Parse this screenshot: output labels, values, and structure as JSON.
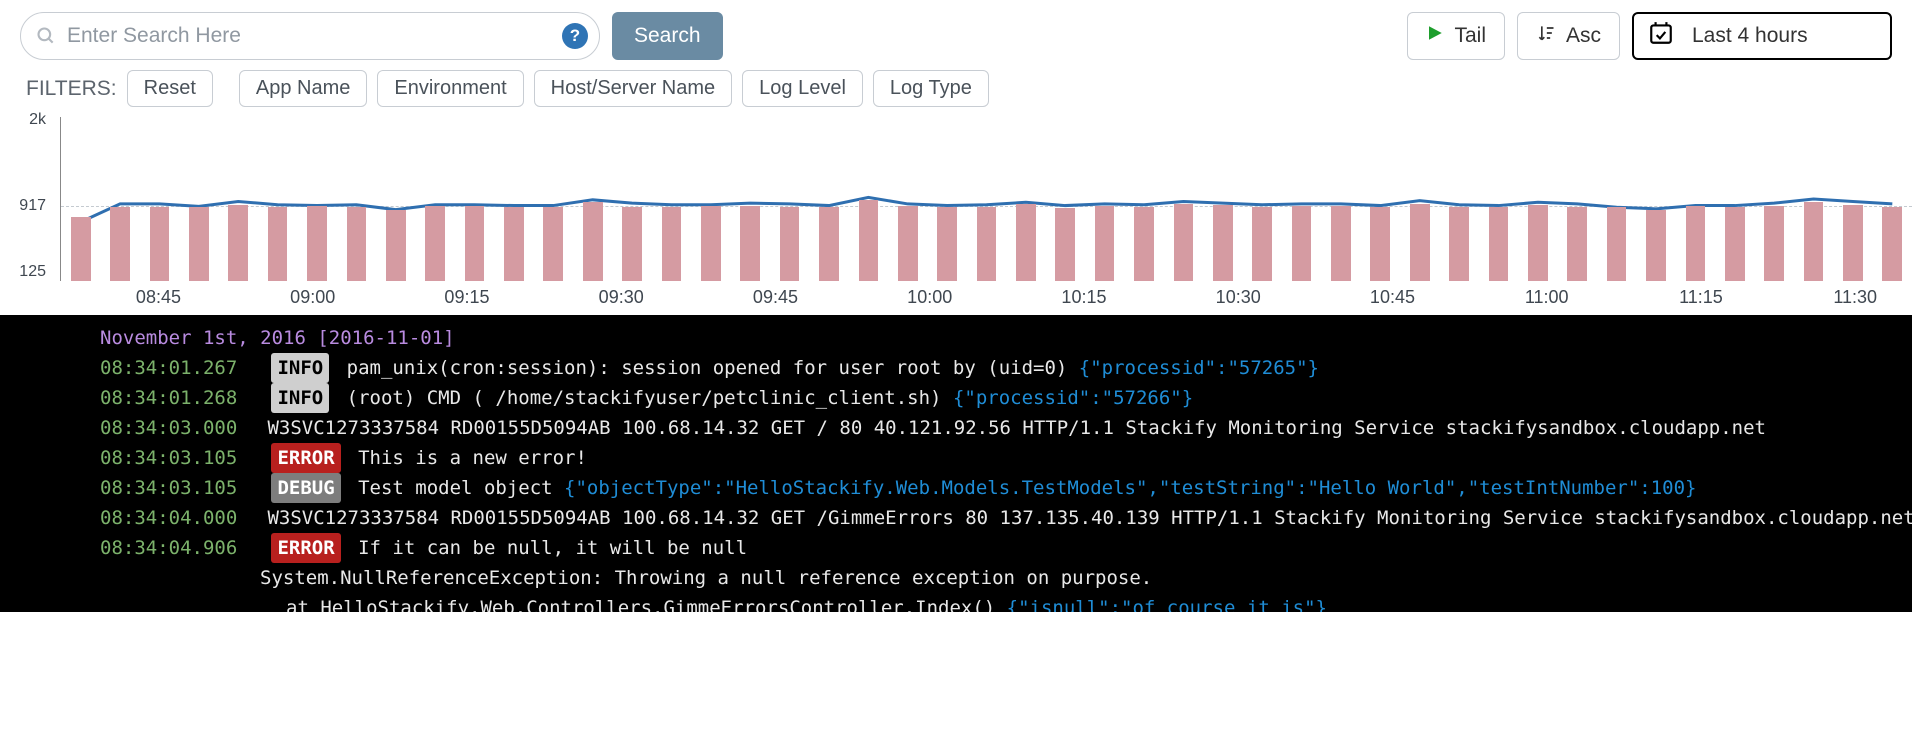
{
  "search": {
    "placeholder": "Enter Search Here",
    "button_label": "Search"
  },
  "toolbar": {
    "tail_label": "Tail",
    "sort_label": "Asc",
    "range_label": "Last 4 hours"
  },
  "filters": {
    "title": "FILTERS:",
    "reset": "Reset",
    "chips": [
      "App Name",
      "Environment",
      "Host/Server Name",
      "Log Level",
      "Log Type"
    ]
  },
  "chart_data": {
    "type": "bar+line",
    "ylabel": "",
    "yticks": [
      2000,
      917,
      125
    ],
    "ytick_labels": [
      "2k",
      "917",
      "125"
    ],
    "ylim": [
      0,
      2000
    ],
    "xticks": [
      "08:45",
      "09:00",
      "09:15",
      "09:30",
      "09:45",
      "10:00",
      "10:15",
      "10:30",
      "10:45",
      "11:00",
      "11:15",
      "11:30"
    ],
    "bars": [
      780,
      900,
      900,
      900,
      930,
      900,
      910,
      900,
      860,
      910,
      920,
      900,
      900,
      960,
      900,
      900,
      910,
      920,
      900,
      900,
      990,
      910,
      900,
      900,
      940,
      890,
      920,
      900,
      940,
      930,
      900,
      920,
      910,
      900,
      940,
      900,
      900,
      930,
      900,
      900,
      870,
      910,
      900,
      920,
      960,
      930,
      900
    ],
    "line": [
      720,
      940,
      940,
      910,
      970,
      930,
      920,
      930,
      870,
      930,
      930,
      920,
      920,
      990,
      950,
      930,
      930,
      950,
      940,
      920,
      1020,
      940,
      920,
      930,
      960,
      920,
      940,
      930,
      970,
      950,
      930,
      940,
      940,
      920,
      980,
      930,
      920,
      960,
      940,
      900,
      880,
      920,
      920,
      950,
      1000,
      970,
      940
    ]
  },
  "logs": {
    "date_line": "November 1st, 2016 [2016-11-01]",
    "rows": [
      {
        "ts": "08:34:01.267",
        "level": "INFO",
        "text": "pam_unix(cron:session): session opened for user root by (uid=0) ",
        "json": "{\"processid\":\"57265\"}"
      },
      {
        "ts": "08:34:01.268",
        "level": "INFO",
        "text": "(root) CMD (   /home/stackifyuser/petclinic_client.sh) ",
        "json": "{\"processid\":\"57266\"}"
      },
      {
        "ts": "08:34:03.000",
        "level": "",
        "text": "W3SVC1273337584 RD00155D5094AB 100.68.14.32 GET / 80 40.121.92.56 HTTP/1.1 Stackify Monitoring Service stackifysandbox.cloudapp.net"
      },
      {
        "ts": "08:34:03.105",
        "level": "ERROR",
        "text": "This is a new error!"
      },
      {
        "ts": "08:34:03.105",
        "level": "DEBUG",
        "text": "Test model object ",
        "json": "{\"objectType\":\"HelloStackify.Web.Models.TestModels\",\"testString\":\"Hello World\",\"testIntNumber\":100}"
      },
      {
        "ts": "08:34:04.000",
        "level": "",
        "text": "W3SVC1273337584 RD00155D5094AB 100.68.14.32 GET /GimmeErrors 80 137.135.40.139 HTTP/1.1 Stackify Monitoring Service stackifysandbox.cloudapp.net"
      },
      {
        "ts": "08:34:04.906",
        "level": "ERROR",
        "text": "If it can be null, it will be null",
        "cont1": "System.NullReferenceException: Throwing a null reference exception on purpose.",
        "cont2": "   at HelloStackify.Web.Controllers.GimmeErrorsController.Index() ",
        "cont2_json": "{\"isnull\":\"of course it is\"}"
      }
    ]
  }
}
